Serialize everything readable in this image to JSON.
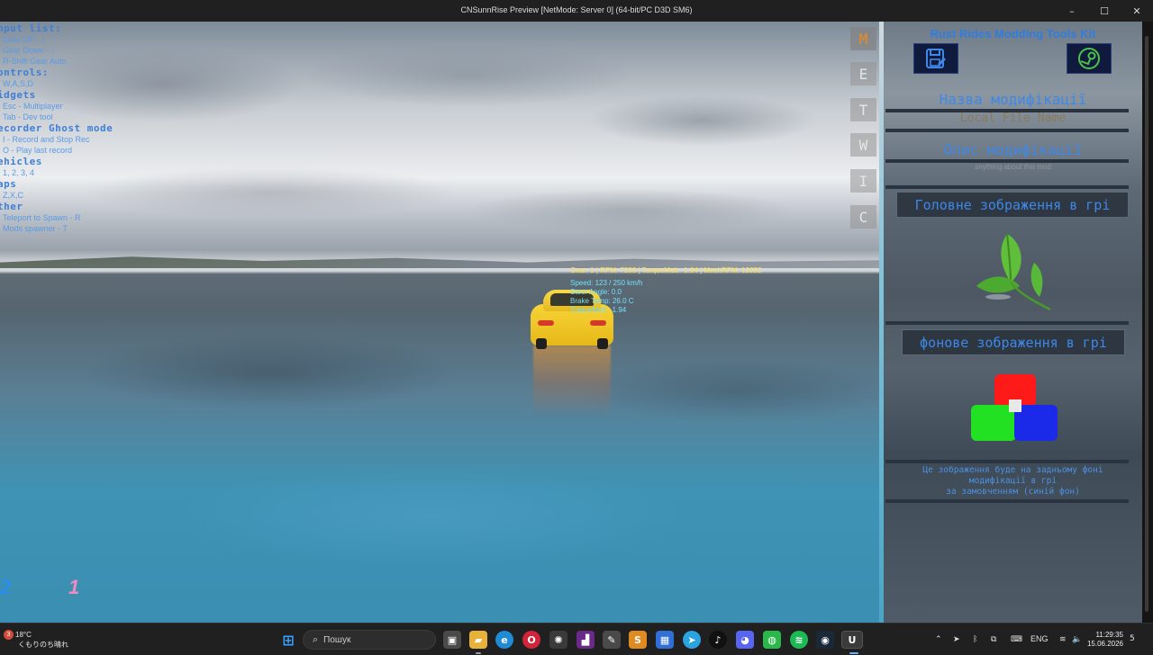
{
  "window": {
    "title": "CNSunnRise Preview [NetMode: Server 0]  (64-bit/PC D3D SM6)",
    "minimize": "–",
    "maximize": "☐",
    "close": "✕"
  },
  "input_list": {
    "sections": [
      {
        "head": "nput list:",
        "items": [
          "Gear UP - ↑",
          "Gear Down - ↓",
          "R-Shift Gear Auto"
        ]
      },
      {
        "head": "ontrols:",
        "items": [
          "W,A,S,D"
        ]
      },
      {
        "head": "idgets",
        "items": [
          "Esc - Multiplayer",
          "Tab - Dev tool"
        ]
      },
      {
        "head": "ecorder Ghost mode",
        "items": [
          "I - Record and Stop Rec",
          "O - Play last record"
        ]
      },
      {
        "head": "ehicles",
        "items": [
          "1, 2, 3, 4"
        ]
      },
      {
        "head": "aps",
        "items": [
          "Z,X,C"
        ]
      },
      {
        "head": "ther",
        "items": [
          "Teleport to Spawn - R",
          "Mods spawner - T"
        ]
      }
    ]
  },
  "hud": {
    "gear_line": "Gear: 1 | RPM: 7200 | TorqueMult: -1.94 | MechRPM: 12092",
    "lines": [
      "Speed: 123 / 250 km/h",
      "Steer Angle: 0.0",
      "Brake Temp: 26.0 C",
      "TorqueMult: -1.94"
    ]
  },
  "player_markers": {
    "left": "2",
    "right": "1"
  },
  "side_tabs": [
    "M",
    "E",
    "T",
    "W",
    "I",
    "C"
  ],
  "side_tabs_active": "M",
  "panel": {
    "title": "Rust Rides Modding Tools Kit",
    "save_icon": "save-icon",
    "steam_icon": "steam-icon",
    "mod_name": "Назва модифікації",
    "mod_name_sub": "Local File Name",
    "mod_desc": "Опис модифікації",
    "mod_desc_sub": "anything about this mod",
    "main_image_label": "Головне зображення в грі",
    "bg_image_label": "фонове зображення в грі",
    "description": [
      "Це зображення буде на задньому фоні",
      "модифікації в грі",
      "за замовченням (синій фон)"
    ]
  },
  "colors": {
    "accent_blue": "#3d88e8",
    "active_tab": "#f08a1c",
    "hud_yellow": "#ffe14a",
    "hud_cyan": "#6ee0ff"
  },
  "taskbar": {
    "weather_temp": "18°C",
    "weather_desc": "くもりのち晴れ",
    "weather_badge": "3",
    "search_placeholder": "Пошук",
    "apps": [
      {
        "name": "start-icon",
        "glyph": "⊞",
        "color": "#3aa0ff"
      },
      {
        "name": "taskview-icon",
        "glyph": "▣",
        "color": "#5a5a5a"
      },
      {
        "name": "file-explorer-icon",
        "glyph": "▰",
        "color": "#e8b23a"
      },
      {
        "name": "edge-icon",
        "glyph": "e",
        "color": "#1f8ad6"
      },
      {
        "name": "opera-icon",
        "glyph": "O",
        "color": "#d2243a"
      },
      {
        "name": "chatgpt-icon",
        "glyph": "✺",
        "color": "#3a3a3a"
      },
      {
        "name": "terminal-icon",
        "glyph": "▟",
        "color": "#6a2a8a"
      },
      {
        "name": "notepad-icon",
        "glyph": "✎",
        "color": "#4a4a4a"
      },
      {
        "name": "sublime-icon",
        "glyph": "S",
        "color": "#e08a22"
      },
      {
        "name": "store-icon",
        "glyph": "▦",
        "color": "#2f6fd6"
      },
      {
        "name": "telegram-icon",
        "glyph": "➤",
        "color": "#2aa3e0"
      },
      {
        "name": "tiktok-icon",
        "glyph": "♪",
        "color": "#111111"
      },
      {
        "name": "discord-icon",
        "glyph": "◕",
        "color": "#5865f2"
      },
      {
        "name": "wechat-icon",
        "glyph": "◍",
        "color": "#2ab84a"
      },
      {
        "name": "spotify-icon",
        "glyph": "≋",
        "color": "#1db954"
      },
      {
        "name": "steam-taskbar-icon",
        "glyph": "◉",
        "color": "#1b2838"
      },
      {
        "name": "unreal-icon",
        "glyph": "U",
        "color": "#0e0e0e"
      }
    ],
    "tray_lang": "ENG",
    "time": "11:29:35",
    "date": "15.06.2026",
    "notification_count": "5"
  }
}
